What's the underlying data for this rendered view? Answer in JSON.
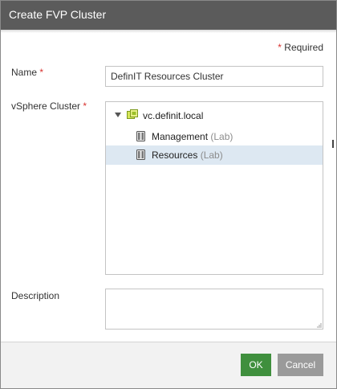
{
  "dialog": {
    "title": "Create FVP Cluster",
    "required_mark": "*",
    "required_text": "Required"
  },
  "form": {
    "name_label": "Name",
    "name_required_mark": "*",
    "name_value": "DefinIT Resources Cluster",
    "cluster_label": "vSphere Cluster",
    "cluster_required_mark": "*",
    "description_label": "Description",
    "description_value": ""
  },
  "tree": {
    "root": {
      "label": "vc.definit.local",
      "icon": "vcenter-icon",
      "expanded": true
    },
    "items": [
      {
        "name": "Management",
        "suffix": "(Lab)",
        "icon": "cluster-icon",
        "selected": false
      },
      {
        "name": "Resources",
        "suffix": "(Lab)",
        "icon": "cluster-icon",
        "selected": true
      }
    ]
  },
  "footer": {
    "ok_label": "OK",
    "cancel_label": "Cancel"
  },
  "colors": {
    "titlebar": "#5b5b5b",
    "ok_button": "#3f8f3d",
    "cancel_button": "#9a9a9a",
    "required_asterisk": "#d9322f",
    "selection": "#dde8f2"
  }
}
